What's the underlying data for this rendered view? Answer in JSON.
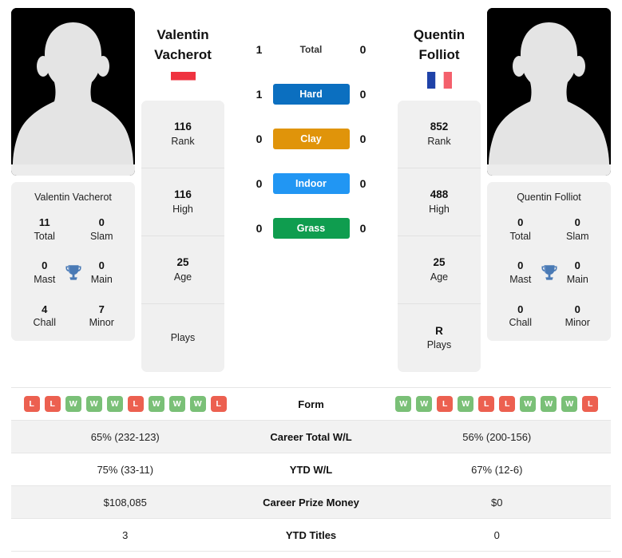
{
  "players": {
    "left": {
      "name": "Valentin Vacherot",
      "name_line1": "Valentin",
      "name_line2": "Vacherot",
      "flag": "monaco-flag",
      "info": [
        {
          "value": "116",
          "label": "Rank"
        },
        {
          "value": "116",
          "label": "High"
        },
        {
          "value": "25",
          "label": "Age"
        },
        {
          "value": "",
          "label": "Plays"
        }
      ],
      "titles": [
        {
          "value": "11",
          "label": "Total"
        },
        {
          "value": "0",
          "label": "Slam"
        },
        {
          "value": "0",
          "label": "Mast"
        },
        {
          "value": "0",
          "label": "Main"
        },
        {
          "value": "4",
          "label": "Chall"
        },
        {
          "value": "7",
          "label": "Minor"
        }
      ],
      "form": [
        "L",
        "L",
        "W",
        "W",
        "W",
        "L",
        "W",
        "W",
        "W",
        "L"
      ]
    },
    "right": {
      "name": "Quentin Folliot",
      "name_line1": "Quentin",
      "name_line2": "Folliot",
      "flag": "france-flag",
      "info": [
        {
          "value": "852",
          "label": "Rank"
        },
        {
          "value": "488",
          "label": "High"
        },
        {
          "value": "25",
          "label": "Age"
        },
        {
          "value": "R",
          "label": "Plays"
        }
      ],
      "titles": [
        {
          "value": "0",
          "label": "Total"
        },
        {
          "value": "0",
          "label": "Slam"
        },
        {
          "value": "0",
          "label": "Mast"
        },
        {
          "value": "0",
          "label": "Main"
        },
        {
          "value": "0",
          "label": "Chall"
        },
        {
          "value": "0",
          "label": "Minor"
        }
      ],
      "form": [
        "W",
        "W",
        "L",
        "W",
        "L",
        "L",
        "W",
        "W",
        "W",
        "L"
      ]
    }
  },
  "head_to_head": [
    {
      "label": "Total",
      "left": "1",
      "right": "0",
      "color": "",
      "styled": false
    },
    {
      "label": "Hard",
      "left": "1",
      "right": "0",
      "color": "#0b6fc0",
      "styled": true
    },
    {
      "label": "Clay",
      "left": "0",
      "right": "0",
      "color": "#e0940a",
      "styled": true
    },
    {
      "label": "Indoor",
      "left": "0",
      "right": "0",
      "color": "#2196f3",
      "styled": true
    },
    {
      "label": "Grass",
      "left": "0",
      "right": "0",
      "color": "#0f9d4f",
      "styled": true
    }
  ],
  "stats_rows": [
    {
      "label": "Form",
      "left": "",
      "right": "",
      "type": "form"
    },
    {
      "label": "Career Total W/L",
      "left": "65% (232-123)",
      "right": "56% (200-156)",
      "type": "text"
    },
    {
      "label": "YTD W/L",
      "left": "75% (33-11)",
      "right": "67% (12-6)",
      "type": "text"
    },
    {
      "label": "Career Prize Money",
      "left": "$108,085",
      "right": "$0",
      "type": "text"
    },
    {
      "label": "YTD Titles",
      "left": "3",
      "right": "0",
      "type": "text"
    }
  ],
  "colors": {
    "hard": "#0b6fc0",
    "clay": "#e0940a",
    "indoor": "#2196f3",
    "grass": "#0f9d4f",
    "win": "#7ac077",
    "loss": "#ec6050",
    "trophy": "#4a7ab5",
    "card_bg": "#f0f0f0"
  },
  "icons": {
    "trophy": "trophy-icon",
    "avatar": "player-avatar-placeholder"
  }
}
